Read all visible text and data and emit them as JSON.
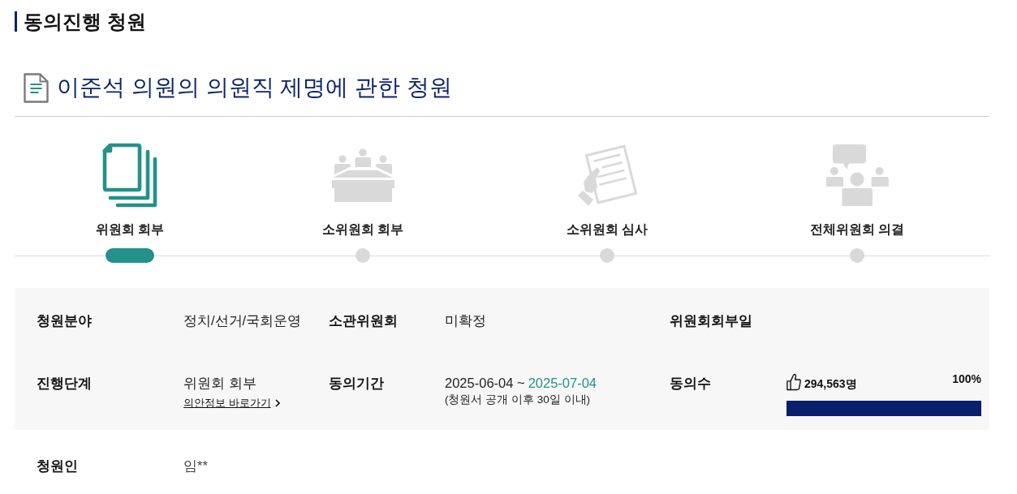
{
  "section_title": "동의진행 청원",
  "petition_title": "이준석 의원의 의원직 제명에 관한 청원",
  "steps": [
    {
      "kind": "referral",
      "label": "위원회 회부",
      "selected": true
    },
    {
      "kind": "meeting",
      "label": "소위원회 회부",
      "selected": false
    },
    {
      "kind": "review",
      "label": "소위원회 심사",
      "selected": false
    },
    {
      "kind": "vote",
      "label": "전체위원회 의결",
      "selected": false
    }
  ],
  "details": {
    "rows": [
      [
        {
          "kind": "text",
          "label": "청원분야",
          "value": "정치/선거/국회운영"
        },
        {
          "kind": "text",
          "label": "소관위원회",
          "value": "미확정"
        },
        {
          "kind": "text",
          "label": "위원회회부일"
        }
      ],
      [
        {
          "kind": "stage",
          "label": "진행단계",
          "value": "위원회 회부",
          "link": "의안정보 바로가기"
        },
        {
          "kind": "period",
          "label": "동의기간",
          "start": "2025-06-04 ~",
          "end": "2025-07-04",
          "note": "(청원서 공개 이후 30일 이내)"
        },
        {
          "kind": "consent",
          "label": "동의수",
          "count": "294,563명",
          "percent": "100%",
          "level": 1
        }
      ]
    ]
  },
  "petitioner": {
    "label": "청원인",
    "value": "임**"
  }
}
